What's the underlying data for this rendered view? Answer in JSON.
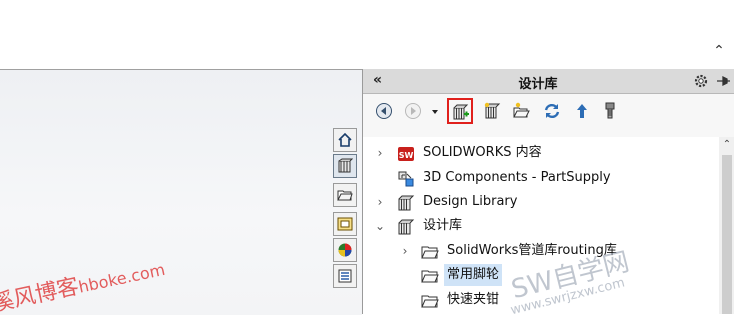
{
  "panel": {
    "title": "设计库",
    "collapse_glyph": "«"
  },
  "toolbar": {
    "buttons": [
      {
        "name": "back-icon"
      },
      {
        "name": "forward-icon"
      },
      {
        "name": "dropdown-arrow-icon"
      },
      {
        "name": "add-to-library-icon"
      },
      {
        "name": "add-file-location-icon"
      },
      {
        "name": "create-new-folder-icon"
      },
      {
        "name": "refresh-icon"
      },
      {
        "name": "up-one-level-icon"
      },
      {
        "name": "generate-toolbox-icon"
      }
    ]
  },
  "side_tabs": [
    {
      "name": "home-tab-icon"
    },
    {
      "name": "design-library-tab-icon"
    },
    {
      "name": "file-explorer-tab-icon"
    },
    {
      "name": "view-palette-tab-icon"
    },
    {
      "name": "appearances-tab-icon"
    },
    {
      "name": "custom-properties-tab-icon"
    }
  ],
  "tree": {
    "items": [
      {
        "label": "SOLIDWORKS 内容",
        "icon": "solidworks-content-icon",
        "expander": "›"
      },
      {
        "label": "3D Components - PartSupply",
        "icon": "3d-components-icon",
        "expander": ""
      },
      {
        "label": "Design Library",
        "icon": "library-icon",
        "expander": "›"
      },
      {
        "label": "设计库",
        "icon": "library-icon",
        "expander": "⌄"
      },
      {
        "label": "SolidWorks管道库routing库",
        "icon": "folder-icon",
        "expander": "›"
      },
      {
        "label": "常用脚轮",
        "icon": "folder-icon",
        "expander": "",
        "selected": true
      },
      {
        "label": "快速夹钳",
        "icon": "folder-icon",
        "expander": ""
      }
    ]
  },
  "watermarks": {
    "left_main": "溪风博客",
    "left_sub": "hboke.com",
    "right_main": "SW自学网",
    "right_sub": "www.swrjzxw.com"
  },
  "colors": {
    "highlight_border": "#e0201c",
    "selection": "#cfe3f7",
    "header": "#dadada"
  }
}
